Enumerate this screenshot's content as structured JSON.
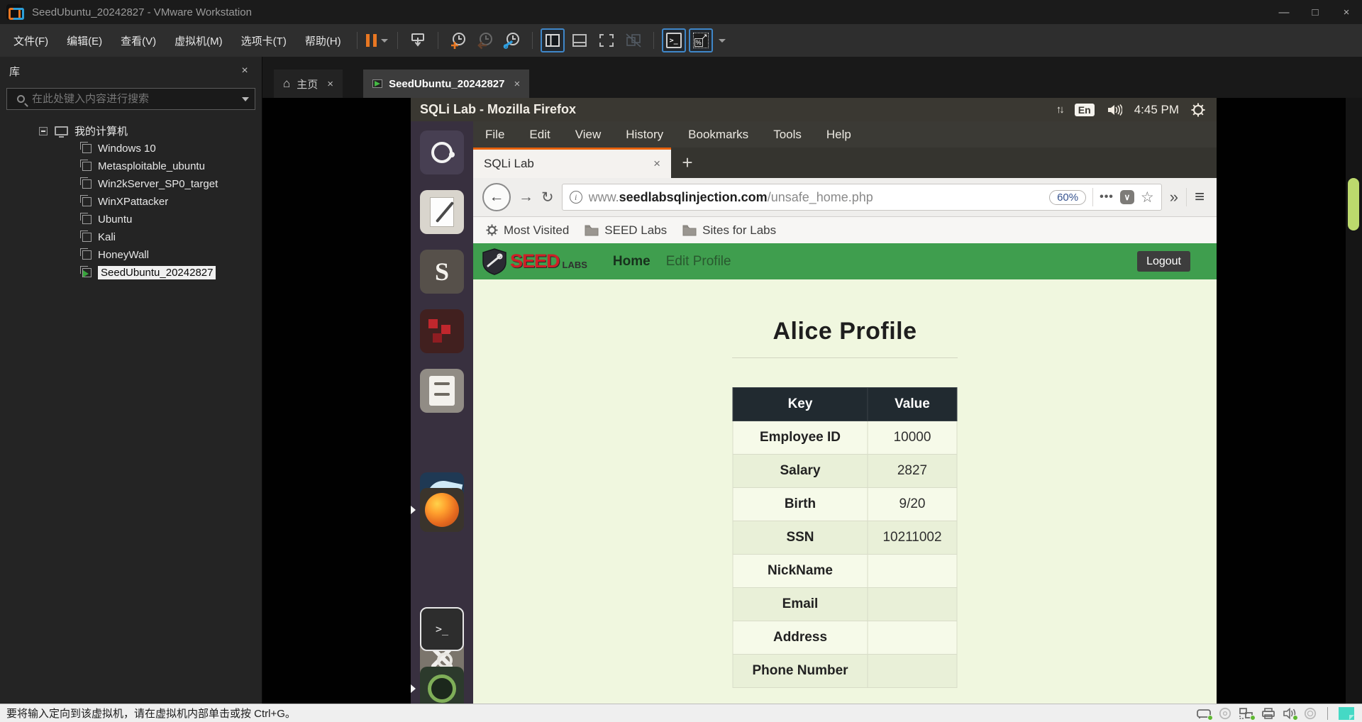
{
  "titlebar": {
    "title": "SeedUbuntu_20242827 - VMware Workstation",
    "minimize_glyph": "—",
    "maximize_glyph": "□",
    "close_glyph": "×"
  },
  "vmware_menu": [
    "文件(F)",
    "编辑(E)",
    "查看(V)",
    "虚拟机(M)",
    "选项卡(T)",
    "帮助(H)"
  ],
  "library": {
    "title": "库",
    "close_glyph": "×",
    "search_placeholder": "在此处键入内容进行搜索",
    "root_item": "我的计算机",
    "vm_items": [
      "Windows 10",
      "Metasploitable_ubuntu",
      "Win2kServer_SP0_target",
      "WinXPattacker",
      "Ubuntu",
      "Kali",
      "HoneyWall"
    ],
    "selected_item": "SeedUbuntu_20242827"
  },
  "tabstrip": {
    "home_tab": "主页",
    "vm_tab": "SeedUbuntu_20242827",
    "close_glyph": "×",
    "home_icon": "⌂"
  },
  "vm_topbar": {
    "title": "SQLi Lab - Mozilla Firefox",
    "updown_icon": "↑↓",
    "lang_badge": "En",
    "clock": "4:45 PM"
  },
  "firefox": {
    "menu": [
      "File",
      "Edit",
      "View",
      "History",
      "Bookmarks",
      "Tools",
      "Help"
    ],
    "tab_title": "SQLi Lab",
    "tab_close_glyph": "×",
    "new_tab_glyph": "+",
    "back_glyph": "←",
    "forward_glyph": "→",
    "reload_glyph": "↻",
    "info_glyph": "i",
    "url": {
      "prefix": "www.",
      "domain": "seedlabsqlinjection.com",
      "path": "/unsafe_home.php"
    },
    "zoom_badge": "60%",
    "dots_glyph": "•••",
    "pocket_glyph": "∨",
    "star_glyph": "☆",
    "overflow_glyph": "»",
    "menu_button_glyph": "≡",
    "bookmarks": [
      "Most Visited",
      "SEED Labs",
      "Sites for Labs"
    ]
  },
  "webpage": {
    "brand": {
      "seed": "SEED",
      "labs": "LABS"
    },
    "nav": {
      "home": "Home",
      "edit_profile": "Edit Profile",
      "logout": "Logout"
    },
    "heading": "Alice Profile",
    "profile_table": {
      "headers": [
        "Key",
        "Value"
      ],
      "rows": [
        {
          "key": "Employee ID",
          "value": "10000"
        },
        {
          "key": "Salary",
          "value": "2827"
        },
        {
          "key": "Birth",
          "value": "9/20"
        },
        {
          "key": "SSN",
          "value": "10211002"
        },
        {
          "key": "NickName",
          "value": ""
        },
        {
          "key": "Email",
          "value": ""
        },
        {
          "key": "Address",
          "value": ""
        },
        {
          "key": "Phone Number",
          "value": ""
        }
      ]
    }
  },
  "statusbar": {
    "hint": "要将输入定向到该虚拟机，请在虚拟机内部单击或按 Ctrl+G。"
  },
  "colors": {
    "vmware_orange": "#e87722",
    "firefox_tab_accent": "#e8620d",
    "seed_green": "#3f9e4e",
    "brand_red": "#cf2027",
    "scroll_thumb": "#bcd96d",
    "note_teal": "#45d9c5",
    "status_ok_green": "#5fb832"
  }
}
